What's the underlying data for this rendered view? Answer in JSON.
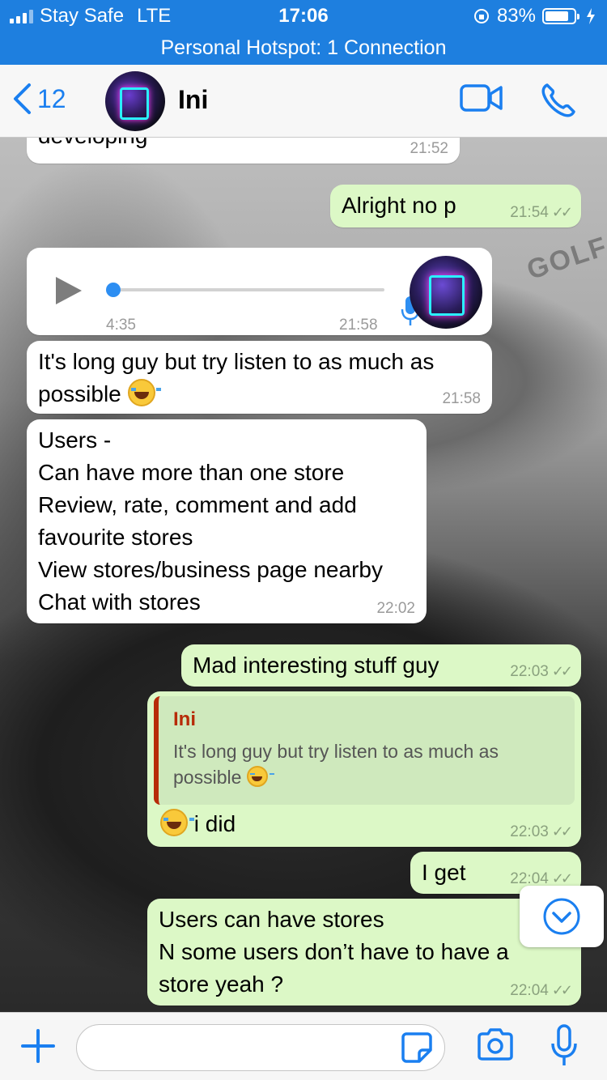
{
  "status": {
    "carrier": "Stay Safe",
    "network": "LTE",
    "time": "17:06",
    "battery": "83%",
    "battery_level": 0.83
  },
  "hotspot": "Personal Hotspot: 1 Connection",
  "header": {
    "back_count": "12",
    "contact_name": "Ini"
  },
  "messages": [
    {
      "text": "developing",
      "time": "21:52",
      "direction": "incoming"
    },
    {
      "text": "Alright no p",
      "time": "21:54",
      "direction": "outgoing"
    },
    {
      "type": "voice",
      "duration": "4:35",
      "time": "21:58",
      "direction": "incoming",
      "progress": 0
    },
    {
      "text": "It's long guy but try listen to as much as possible",
      "time": "21:58",
      "direction": "incoming"
    },
    {
      "lines": [
        "Users -",
        "Can have more than one store",
        "Review, rate, comment and add",
        "favourite stores",
        "View stores/business page nearby",
        "Chat with stores"
      ],
      "time": "22:02",
      "direction": "incoming"
    },
    {
      "text": "Mad interesting stuff guy",
      "time": "22:03",
      "direction": "outgoing"
    },
    {
      "quote_name": "Ini",
      "quote_text": "It's long guy but try listen to as much as possible",
      "text": "i did",
      "time": "22:03",
      "direction": "outgoing"
    },
    {
      "text": "I get",
      "time": "22:04",
      "direction": "outgoing"
    },
    {
      "lines": [
        "Users can have stores",
        "N some users don’t have to have a",
        "store yeah ?"
      ],
      "time": "22:04",
      "direction": "outgoing"
    }
  ],
  "wallpaper_text": "GOLF",
  "colors": {
    "accent": "#1a7ff0",
    "status_bar": "#1e7fdf",
    "outgoing_bubble": "#dcf8c6",
    "incoming_bubble": "#ffffff",
    "quote_accent": "#b72b08"
  },
  "icons": {
    "back": "chevron-left-icon",
    "video": "video-camera-icon",
    "call": "phone-icon",
    "attach": "plus-icon",
    "sticker": "sticker-icon",
    "camera": "camera-icon",
    "mic": "microphone-icon",
    "scroll": "chevron-down-circle-icon"
  }
}
